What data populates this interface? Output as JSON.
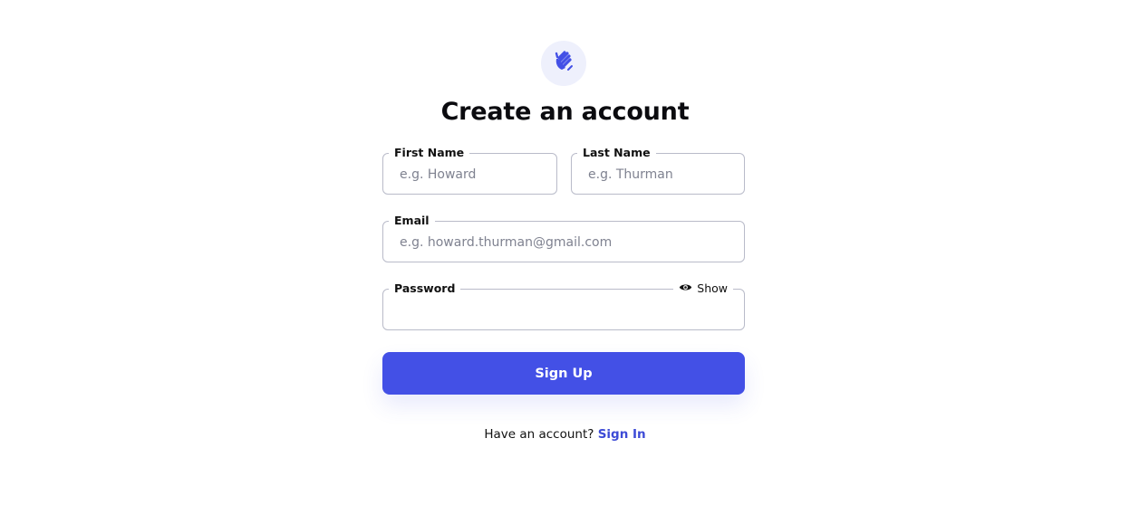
{
  "logo": {
    "icon": "waving-hand-icon",
    "color": "#4350e6",
    "background": "#eef0fc"
  },
  "title": "Create an account",
  "form": {
    "first_name": {
      "label": "First Name",
      "placeholder": "e.g. Howard"
    },
    "last_name": {
      "label": "Last Name",
      "placeholder": "e.g. Thurman"
    },
    "email": {
      "label": "Email",
      "placeholder": "e.g. howard.thurman@gmail.com"
    },
    "password": {
      "label": "Password",
      "placeholder": "",
      "toggle_label": "Show",
      "toggle_icon": "eye-icon"
    },
    "submit_label": "Sign Up"
  },
  "footer": {
    "prompt": "Have an account?",
    "link_label": "Sign In"
  },
  "colors": {
    "accent": "#4350e6",
    "link": "#3d4bd6",
    "border": "#b9bbc9"
  }
}
